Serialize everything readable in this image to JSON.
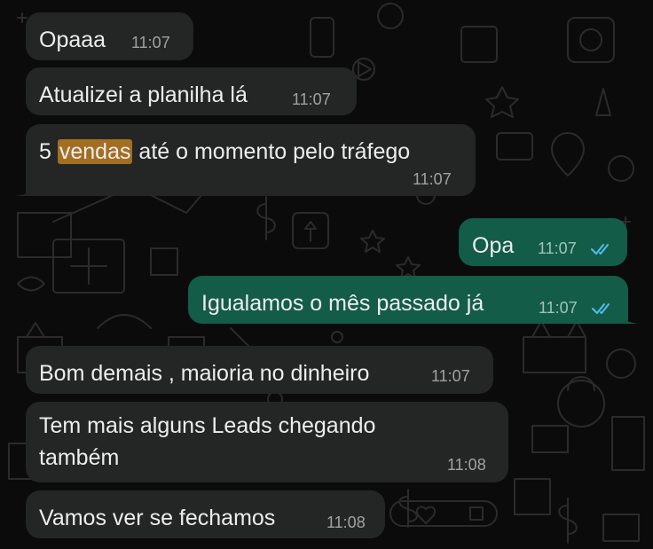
{
  "theme": {
    "incoming_bubble": "#242626",
    "outgoing_bubble": "#135c48",
    "highlight": "#a36d22",
    "read_ticks": "#53bdeb"
  },
  "messages": [
    {
      "direction": "incoming",
      "text": "Opaaa",
      "time": "11:07"
    },
    {
      "direction": "incoming",
      "text": "Atualizei a planilha lá",
      "time": "11:07"
    },
    {
      "direction": "incoming",
      "text_before": "5 ",
      "highlighted_word": "vendas",
      "text_after": " até o momento pelo tráfego",
      "time": "11:07"
    },
    {
      "direction": "outgoing",
      "text": "Opa",
      "time": "11:07",
      "status": "read"
    },
    {
      "direction": "outgoing",
      "text": "Igualamos o mês passado já",
      "time": "11:07",
      "status": "read"
    },
    {
      "direction": "incoming",
      "text": "Bom demais , maioria no dinheiro",
      "time": "11:07"
    },
    {
      "direction": "incoming",
      "text_line1": "Tem mais alguns Leads chegando",
      "text_line2": "também",
      "time": "11:08"
    },
    {
      "direction": "incoming",
      "text": "Vamos ver se fechamos",
      "time": "11:08"
    }
  ]
}
